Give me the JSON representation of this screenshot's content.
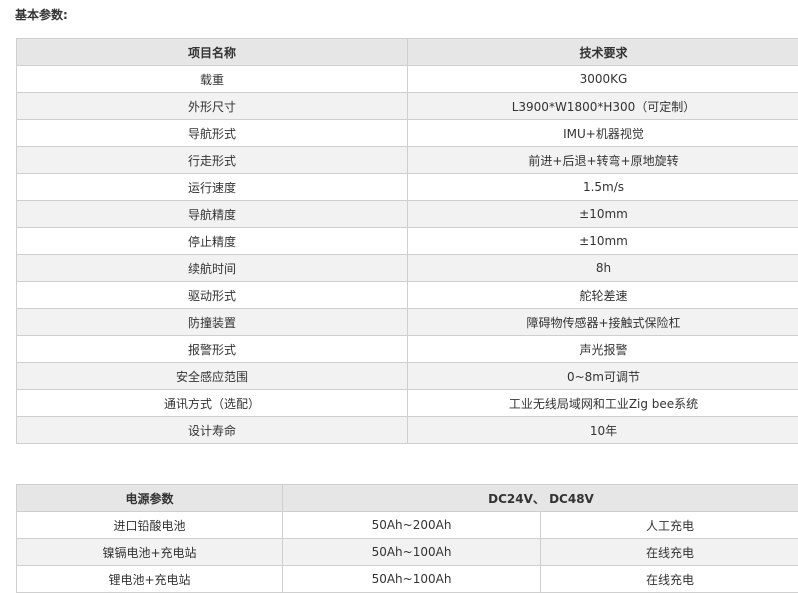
{
  "section_title": "基本参数:",
  "spec_table": {
    "headers": [
      "项目名称",
      "技术要求"
    ],
    "rows": [
      [
        "载重",
        "3000KG"
      ],
      [
        "外形尺寸",
        "L3900*W1800*H300（可定制）"
      ],
      [
        "导航形式",
        "IMU+机器视觉"
      ],
      [
        "行走形式",
        "前进+后退+转弯+原地旋转"
      ],
      [
        "运行速度",
        "1.5m/s"
      ],
      [
        "导航精度",
        "±10mm"
      ],
      [
        "停止精度",
        "±10mm"
      ],
      [
        "续航时间",
        "8h"
      ],
      [
        "驱动形式",
        "舵轮差速"
      ],
      [
        "防撞装置",
        "障碍物传感器+接触式保险杠"
      ],
      [
        "报警形式",
        "声光报警"
      ],
      [
        "安全感应范围",
        "0~8m可调节"
      ],
      [
        "通讯方式（选配）",
        "工业无线局域网和工业Zig bee系统"
      ],
      [
        "设计寿命",
        "10年"
      ]
    ]
  },
  "power_table": {
    "headers": [
      "电源参数",
      "DC24V、 DC48V"
    ],
    "rows": [
      [
        "进口铅酸电池",
        "50Ah~200Ah",
        "人工充电"
      ],
      [
        "镍镉电池+充电站",
        "50Ah~100Ah",
        "在线充电"
      ],
      [
        "锂电池+充电站",
        "50Ah~100Ah",
        "在线充电"
      ]
    ]
  }
}
